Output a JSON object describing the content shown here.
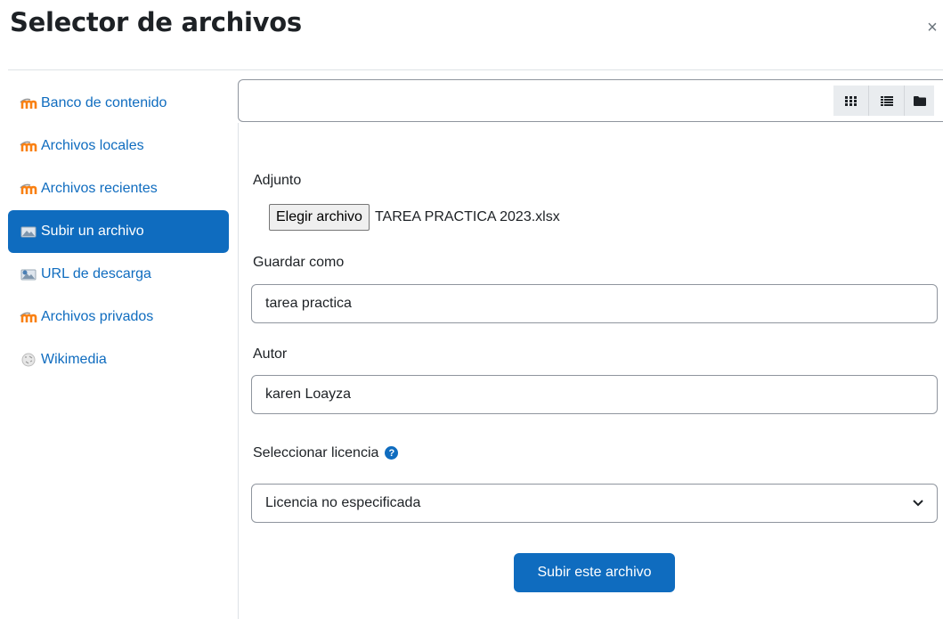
{
  "dialog": {
    "title": "Selector de archivos",
    "close_label": "×"
  },
  "sidebar": {
    "items": [
      {
        "label": "Banco de contenido",
        "icon": "moodle-icon",
        "active": false
      },
      {
        "label": "Archivos locales",
        "icon": "moodle-icon",
        "active": false
      },
      {
        "label": "Archivos recientes",
        "icon": "moodle-icon",
        "active": false
      },
      {
        "label": "Subir un archivo",
        "icon": "upload-icon",
        "active": true
      },
      {
        "label": "URL de descarga",
        "icon": "url-download-icon",
        "active": false
      },
      {
        "label": "Archivos privados",
        "icon": "moodle-icon",
        "active": false
      },
      {
        "label": "Wikimedia",
        "icon": "wikimedia-icon",
        "active": false
      }
    ]
  },
  "toolbar": {
    "views": [
      "icons-view-icon",
      "list-view-icon",
      "folder-view-icon"
    ]
  },
  "form": {
    "attachment_label": "Adjunto",
    "choose_button": "Elegir archivo",
    "file_name": "TAREA PRACTICA 2023.xlsx",
    "save_as_label": "Guardar como",
    "save_as_value": "tarea practica",
    "author_label": "Autor",
    "author_value": "karen Loayza",
    "license_label": "Seleccionar licencia",
    "license_value": "Licencia no especificada",
    "submit_label": "Subir este archivo"
  },
  "colors": {
    "accent": "#0f6cbf",
    "moodle_orange": "#f98012"
  }
}
